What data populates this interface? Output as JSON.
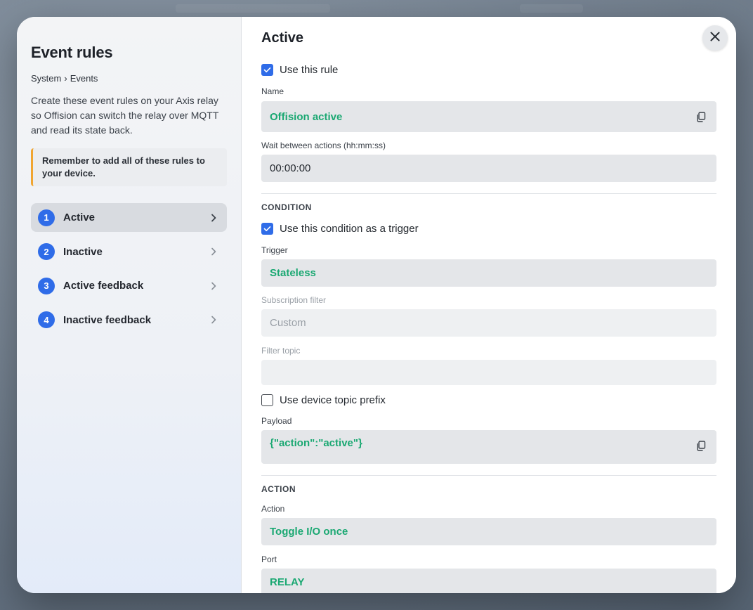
{
  "sidebar": {
    "title": "Event rules",
    "breadcrumb": {
      "part1": "System",
      "separator": "›",
      "part2": "Events"
    },
    "description": "Create these event rules on your Axis relay so Offision can switch the relay over MQTT and read its state back.",
    "notice": "Remember to add all of these rules to your device.",
    "steps": [
      {
        "number": "1",
        "label": "Active"
      },
      {
        "number": "2",
        "label": "Inactive"
      },
      {
        "number": "3",
        "label": "Active feedback"
      },
      {
        "number": "4",
        "label": "Inactive feedback"
      }
    ]
  },
  "main": {
    "title": "Active",
    "use_rule": {
      "label": "Use this rule",
      "checked": true
    },
    "name": {
      "label": "Name",
      "value": "Offision active"
    },
    "wait": {
      "label": "Wait between actions (hh:mm:ss)",
      "value": "00:00:00"
    },
    "condition": {
      "section": "CONDITION",
      "use_trigger": {
        "label": "Use this condition as a trigger",
        "checked": true
      },
      "trigger": {
        "label": "Trigger",
        "value": "Stateless"
      },
      "subscription_filter": {
        "label": "Subscription filter",
        "value": "Custom"
      },
      "filter_topic": {
        "label": "Filter topic",
        "value": ""
      },
      "device_prefix": {
        "label": "Use device topic prefix",
        "checked": false
      },
      "payload": {
        "label": "Payload",
        "value": "{\"action\":\"active\"}"
      }
    },
    "action": {
      "section": "ACTION",
      "action": {
        "label": "Action",
        "value": "Toggle I/O once"
      },
      "port": {
        "label": "Port",
        "value": "RELAY"
      }
    }
  },
  "colors": {
    "accent_blue": "#2f6ce8",
    "value_green": "#1aa872",
    "notice_border": "#f0a531"
  },
  "icons": [
    "close-icon",
    "copy-icon",
    "chevron-right-icon",
    "check-icon"
  ]
}
